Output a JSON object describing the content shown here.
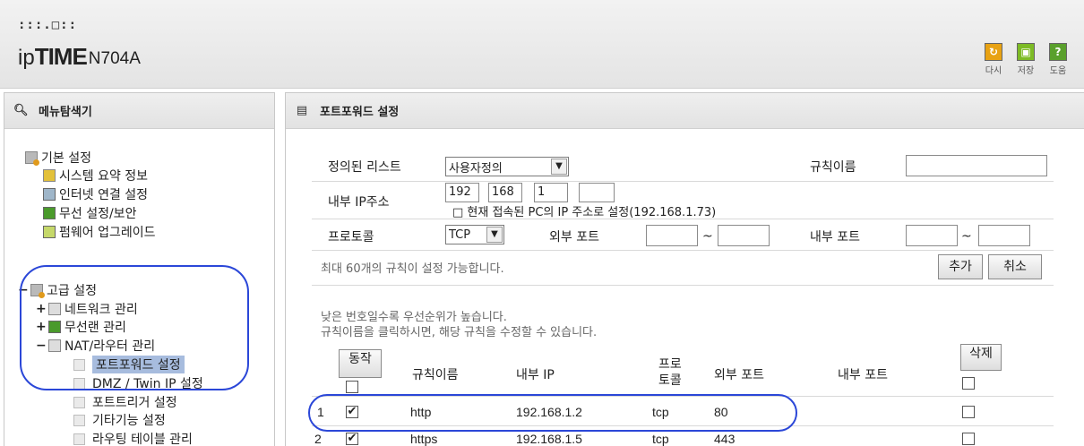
{
  "header": {
    "logo_dots": ":::.□::",
    "logo_ip": "ip",
    "logo_time": "TIME",
    "logo_model": "N704A",
    "buttons": [
      {
        "label": "다시",
        "icon": "reload-icon",
        "color": "#e8a213"
      },
      {
        "label": "저장",
        "icon": "save-icon",
        "color": "#7dbb25"
      },
      {
        "label": "도움",
        "icon": "help-icon",
        "color": "#5aa02c",
        "glyph": "?"
      }
    ]
  },
  "sidebar": {
    "title": "메뉴탐색기",
    "basic": {
      "label": "기본 설정",
      "items": [
        "시스템 요약 정보",
        "인터넷 연결 설정",
        "무선 설정/보안",
        "펌웨어 업그레이드"
      ]
    },
    "advanced": {
      "label": "고급 설정",
      "groups": [
        {
          "label": "네트워크 관리",
          "toggle": "+"
        },
        {
          "label": "무선랜 관리",
          "toggle": "+"
        },
        {
          "label": "NAT/라우터 관리",
          "toggle": "−"
        }
      ],
      "nat_items": [
        "포트포워드 설정",
        "DMZ / Twin IP 설정",
        "포트트리거 설정",
        "기타기능 설정",
        "라우팅 테이블 관리"
      ],
      "selected": "포트포워드 설정"
    }
  },
  "main": {
    "title": "포트포워드 설정",
    "form": {
      "defined_list_label": "정의된 리스트",
      "defined_list_value": "사용자정의",
      "rule_name_label": "규칙이름",
      "rule_name_value": "",
      "internal_ip_label": "내부 IP주소",
      "ip_octets": [
        "192",
        "168",
        "1",
        ""
      ],
      "current_pc_text": "□ 현재 접속된 PC의 IP 주소로 설정(192.168.1.73)",
      "protocol_label": "프로토콜",
      "protocol_value": "TCP",
      "external_port_label": "외부 포트",
      "internal_port_label": "내부 포트",
      "tilde": "~",
      "max_rules_note": "최대 60개의 규칙이 설정 가능합니다.",
      "add_button": "추가",
      "cancel_button": "취소"
    },
    "priority_note": "낮은 번호일수록 우선순위가 높습니다.",
    "click_note": "규칙이름을 클릭하시면, 해당 규칙을 수정할 수 있습니다.",
    "table": {
      "action_button": "동작",
      "headers": {
        "rule_name": "규칙이름",
        "internal_ip": "내부 IP",
        "protocol_line1": "프로",
        "protocol_line2": "토콜",
        "external_port": "외부 포트",
        "internal_port": "내부 포트"
      },
      "delete_button": "삭제",
      "rows": [
        {
          "num": "1",
          "checked": true,
          "name": "http",
          "ip": "192.168.1.2",
          "proto": "tcp",
          "ext_port": "80",
          "int_port": ""
        },
        {
          "num": "2",
          "checked": true,
          "name": "https",
          "ip": "192.168.1.5",
          "proto": "tcp",
          "ext_port": "443",
          "int_port": ""
        }
      ]
    }
  },
  "check_glyph": "✔"
}
